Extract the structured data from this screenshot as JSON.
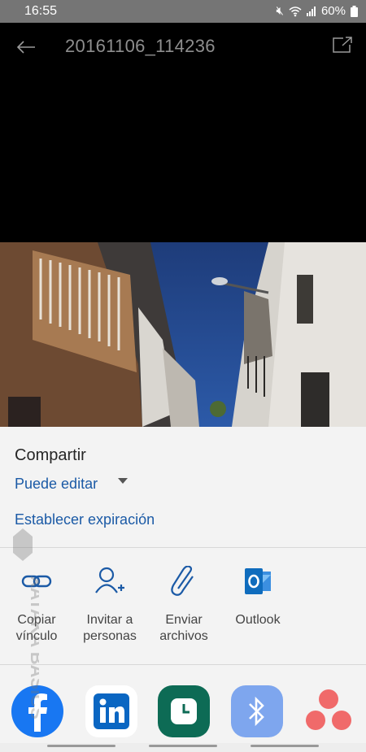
{
  "status": {
    "time": "16:55",
    "battery": "60%"
  },
  "viewer": {
    "title": "20161106_114236"
  },
  "sheet": {
    "title": "Compartir",
    "permission": "Puede editar",
    "expiration": "Establecer expiración",
    "actions": [
      {
        "label1": "Copiar",
        "label2": "vínculo",
        "icon": "link-icon"
      },
      {
        "label1": "Invitar a",
        "label2": "personas",
        "icon": "add-person-icon"
      },
      {
        "label1": "Enviar",
        "label2": "archivos",
        "icon": "paperclip-icon"
      },
      {
        "label1": "Outlook",
        "label2": "",
        "icon": "outlook-icon"
      }
    ],
    "apps": [
      "facebook",
      "linkedin",
      "clock",
      "bluetooth",
      "asana"
    ]
  },
  "watermark": "XATAKA BASICS",
  "colors": {
    "accent": "#1b5aa6",
    "outlook": "#0f6cbd",
    "facebook": "#1877f2",
    "linkedin": "#0a66c2",
    "clock": "#0d6b55",
    "bluetooth": "#7ea6ee",
    "asana": "#f06a6a"
  }
}
